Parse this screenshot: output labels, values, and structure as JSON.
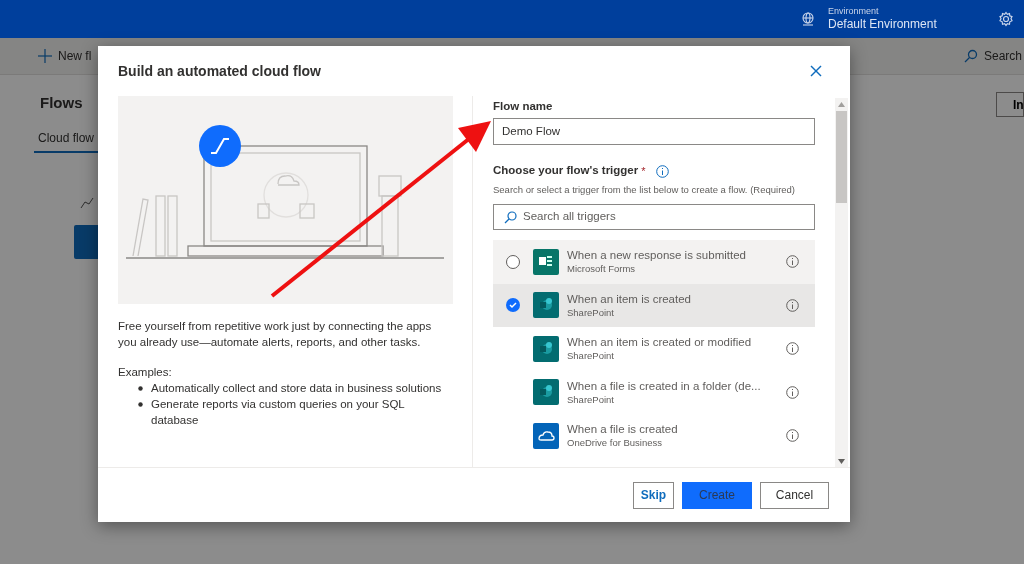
{
  "header": {
    "environment_label": "Environment",
    "environment_name": "Default Environment"
  },
  "background": {
    "new_flow": "New fl",
    "search": "Search",
    "title": "Flows",
    "tab": "Cloud flow",
    "right_button": "In"
  },
  "dialog": {
    "title": "Build an automated cloud flow",
    "description": "Free yourself from repetitive work just by connecting the apps you already use—automate alerts, reports, and other tasks.",
    "examples_label": "Examples:",
    "examples": [
      "Automatically collect and store data in business solutions",
      "Generate reports via custom queries on your SQL database"
    ],
    "flow_name_label": "Flow name",
    "flow_name_value": "Demo Flow",
    "trigger_label": "Choose your flow's trigger",
    "required_mark": "*",
    "trigger_hint": "Search or select a trigger from the list below to create a flow. (Required)",
    "trigger_search": {
      "placeholder": "Search all triggers"
    },
    "triggers": [
      {
        "title": "When a new response is submitted",
        "app": "Microsoft Forms",
        "kind": "forms",
        "color": "#077568",
        "selected": false,
        "hovered": true
      },
      {
        "title": "When an item is created",
        "app": "SharePoint",
        "kind": "sharepoint",
        "color": "#036c70",
        "selected": true,
        "hovered": false
      },
      {
        "title": "When an item is created or modified",
        "app": "SharePoint",
        "kind": "sharepoint",
        "color": "#036c70",
        "selected": false,
        "hovered": false
      },
      {
        "title": "When a file is created in a folder (de...",
        "app": "SharePoint",
        "kind": "sharepoint",
        "color": "#036c70",
        "selected": false,
        "hovered": false
      },
      {
        "title": "When a file is created",
        "app": "OneDrive for Business",
        "kind": "onedrive",
        "color": "#0364b8",
        "selected": false,
        "hovered": false
      }
    ],
    "buttons": [
      {
        "label": "Skip",
        "kind": "secondary"
      },
      {
        "label": "Create",
        "kind": "primary"
      },
      {
        "label": "Cancel",
        "kind": "default"
      }
    ]
  }
}
